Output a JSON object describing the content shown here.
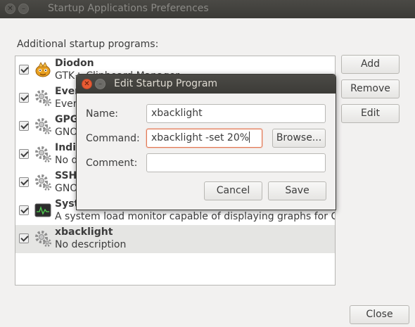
{
  "window": {
    "title": "Startup Applications Preferences",
    "controls": [
      "close-icon",
      "minimize-icon"
    ]
  },
  "main": {
    "section_label": "Additional startup programs:",
    "programs": [
      {
        "name": "Diodon",
        "description": "GTK+ Clipboard Manager",
        "checked": true,
        "icon": "diodon-icon"
      },
      {
        "name": "Ever",
        "description": "Ever",
        "checked": true,
        "icon": "gears-icon"
      },
      {
        "name": "GPG",
        "description": "GNO",
        "checked": true,
        "icon": "gears-icon"
      },
      {
        "name": "Indic",
        "description": "No d",
        "checked": true,
        "icon": "gears-icon"
      },
      {
        "name": "SSH",
        "description": "GNO",
        "checked": true,
        "icon": "gears-icon"
      },
      {
        "name": "Syst",
        "description": "A system load monitor capable of displaying graphs for C...",
        "checked": true,
        "icon": "system-monitor-icon"
      },
      {
        "name": "xbacklight",
        "description": "No description",
        "checked": true,
        "icon": "gears-icon",
        "selected": true
      }
    ],
    "buttons": {
      "add": "Add",
      "remove": "Remove",
      "edit": "Edit",
      "close": "Close"
    }
  },
  "dialog": {
    "title": "Edit Startup Program",
    "name_label": "Name:",
    "name_value": "xbacklight",
    "command_label": "Command:",
    "command_value": "xbacklight -set 20%",
    "browse_label": "Browse...",
    "comment_label": "Comment:",
    "comment_value": "",
    "cancel_label": "Cancel",
    "save_label": "Save"
  },
  "colors": {
    "titlebar": "#3c3b37",
    "close_button": "#e95b33",
    "focus_border": "#e27a55",
    "selected_row": "#e5e5e3"
  }
}
